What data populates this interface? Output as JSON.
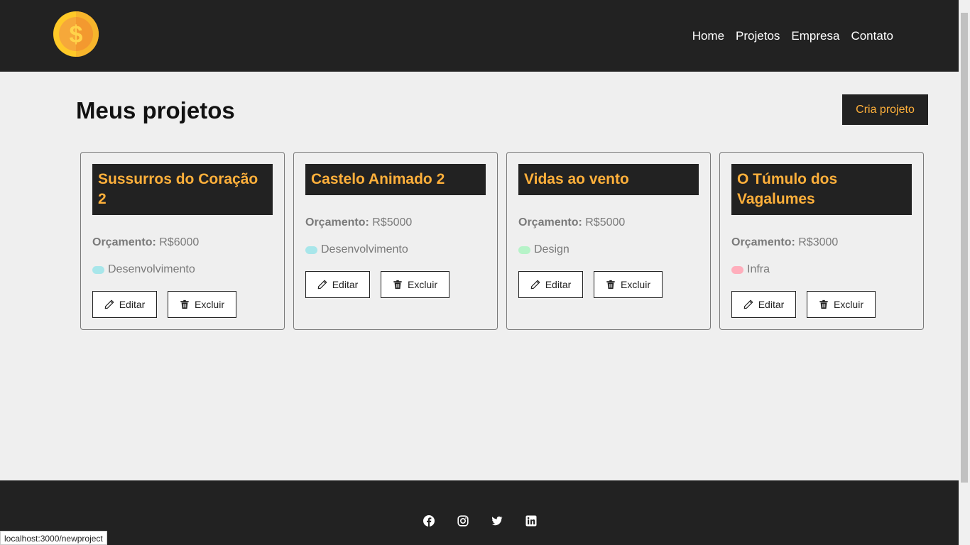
{
  "navbar": {
    "logo": "coin-logo",
    "links": [
      "Home",
      "Projetos",
      "Empresa",
      "Contato"
    ]
  },
  "main": {
    "title": "Meus projetos",
    "create_label": "Cria projeto"
  },
  "projects": [
    {
      "title": "Sussurros do Coração 2",
      "budget_label": "Orçamento:",
      "budget": "R$6000",
      "category": "Desenvolvimento",
      "category_color": "#a8e6ea",
      "edit_label": "Editar",
      "delete_label": "Excluir"
    },
    {
      "title": "Castelo Animado 2",
      "budget_label": "Orçamento:",
      "budget": "R$5000",
      "category": "Desenvolvimento",
      "category_color": "#a8e6ea",
      "edit_label": "Editar",
      "delete_label": "Excluir"
    },
    {
      "title": "Vidas ao vento",
      "budget_label": "Orçamento:",
      "budget": "R$5000",
      "category": "Design",
      "category_color": "#b6f3c8",
      "edit_label": "Editar",
      "delete_label": "Excluir"
    },
    {
      "title": "O Túmulo dos Vagalumes",
      "budget_label": "Orçamento:",
      "budget": "R$3000",
      "category": "Infra",
      "category_color": "#ffaebc",
      "edit_label": "Editar",
      "delete_label": "Excluir"
    }
  ],
  "footer": {
    "social_icons": [
      "facebook-icon",
      "instagram-icon",
      "twitter-icon",
      "linkedin-icon"
    ]
  },
  "status_bar": {
    "url": "localhost:3000/newproject"
  },
  "colors": {
    "dark": "#222222",
    "accent": "#ffb03b",
    "background": "#efefef"
  }
}
